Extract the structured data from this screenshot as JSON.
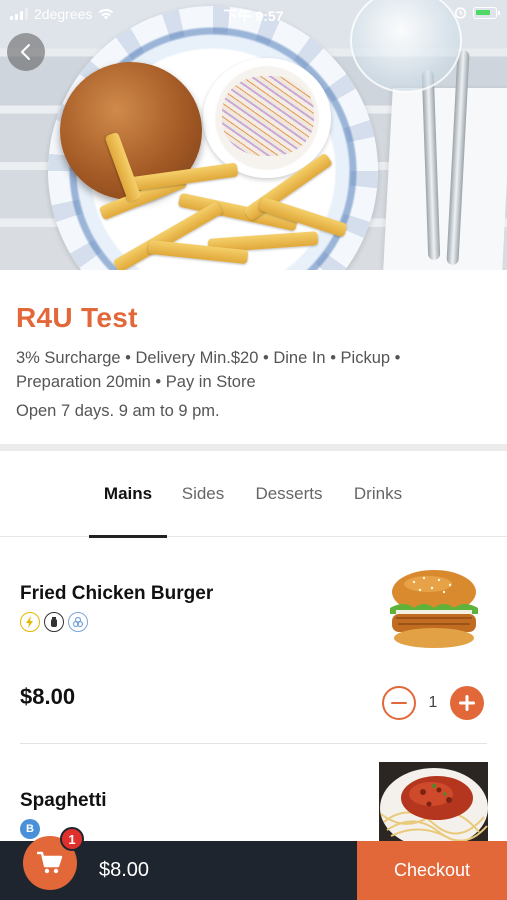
{
  "status_bar": {
    "carrier": "2degrees",
    "time": "下午 9:57",
    "battery_color": "#4cd964"
  },
  "nav": {
    "back_icon": "chevron-left-icon"
  },
  "hero": {
    "image": "burger-fries-coleslaw-plate"
  },
  "restaurant": {
    "name": "R4U Test",
    "details_line1": "3% Surcharge • Delivery Min.$20 • Dine In • Pickup •",
    "details_line2": "Preparation 20min • Pay in Store",
    "hours": "Open 7 days. 9 am to 9 pm."
  },
  "tabs": [
    {
      "label": "Mains",
      "active": true
    },
    {
      "label": "Sides",
      "active": false
    },
    {
      "label": "Desserts",
      "active": false
    },
    {
      "label": "Drinks",
      "active": false
    }
  ],
  "menu": {
    "items": [
      {
        "name": "Fried Chicken Burger",
        "badges": [
          "lightning-icon",
          "salt-shaker-icon",
          "recycle-icon"
        ],
        "price": "$8.00",
        "quantity": "1",
        "image": "fried-chicken-burger"
      },
      {
        "name": "Spaghetti",
        "badges": [
          "b-badge-icon"
        ],
        "badge_text": "B",
        "image": "spaghetti-bolognese"
      }
    ]
  },
  "cart": {
    "count": "1",
    "total": "$8.00",
    "checkout_label": "Checkout"
  },
  "colors": {
    "accent": "#e2683a",
    "bottom_bar": "#1e252e",
    "badge_red": "#e0302e"
  }
}
